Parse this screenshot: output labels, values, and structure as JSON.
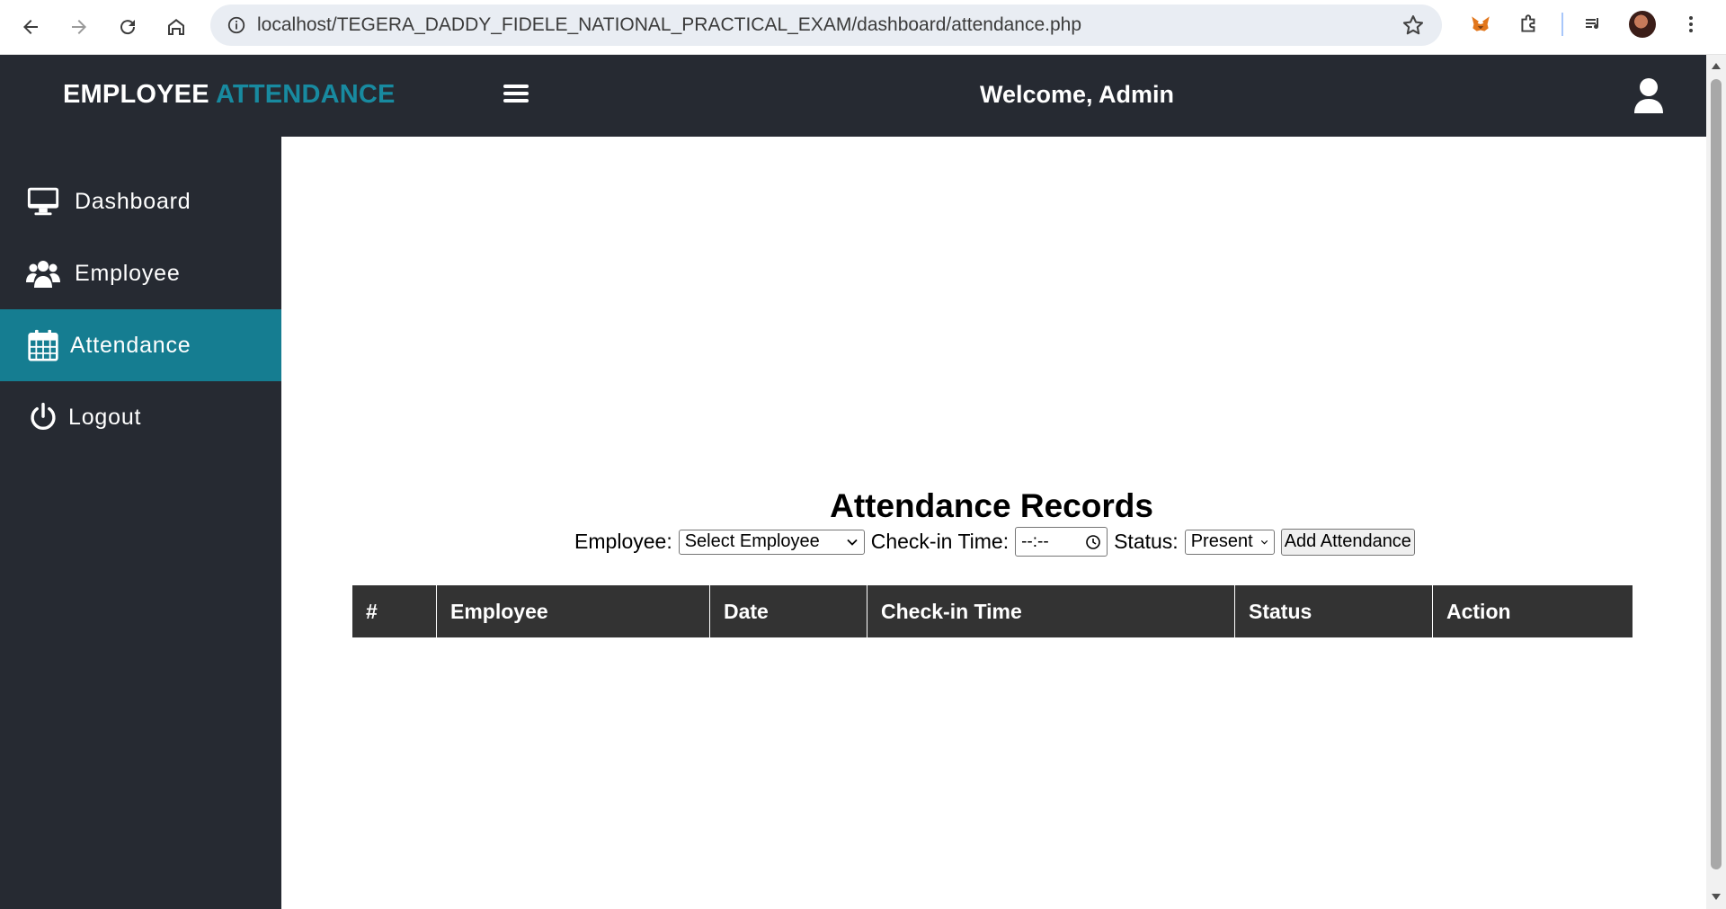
{
  "browser": {
    "url": "localhost/TEGERA_DADDY_FIDELE_NATIONAL_PRACTICAL_EXAM/dashboard/attendance.php"
  },
  "header": {
    "brand_primary": "EMPLOYEE",
    "brand_accent": "ATTENDANCE",
    "welcome": "Welcome, Admin"
  },
  "sidebar": {
    "items": [
      {
        "label": "Dashboard",
        "icon": "monitor-icon"
      },
      {
        "label": "Employee",
        "icon": "users-icon"
      },
      {
        "label": "Attendance",
        "icon": "calendar-icon",
        "active": true
      },
      {
        "label": "Logout",
        "icon": "power-icon"
      }
    ]
  },
  "main": {
    "title": "Attendance Records",
    "form": {
      "employee_label": "Employee:",
      "employee_value": "Select Employee",
      "checkin_label": "Check-in Time:",
      "checkin_value": "--:--",
      "status_label": "Status:",
      "status_value": "Present",
      "submit_label": "Add Attendance"
    },
    "table": {
      "columns": [
        "#",
        "Employee",
        "Date",
        "Check-in Time",
        "Status",
        "Action"
      ],
      "rows": []
    }
  },
  "colors": {
    "dark": "#262a32",
    "accent": "#188aa0",
    "active_item": "#157d91",
    "table_header": "#333333"
  }
}
